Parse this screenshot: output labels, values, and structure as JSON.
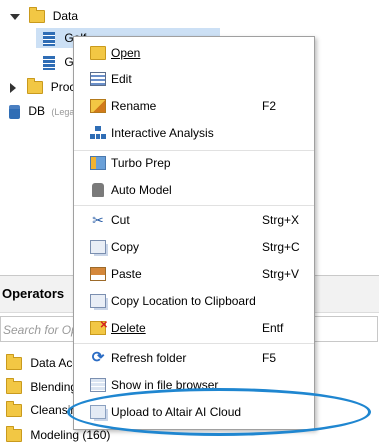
{
  "tree": {
    "data_folder": "Data",
    "item1": "Golf",
    "item2": "Go",
    "processes": "Proce",
    "db": "DB",
    "db_note": "(Lega"
  },
  "operators": {
    "title": "Operators",
    "search_placeholder": "Search for Op",
    "categories": [
      {
        "label": "Data Acc"
      },
      {
        "label": "Blending"
      },
      {
        "label": "Cleansin"
      },
      {
        "label": "Modeling (160)"
      }
    ]
  },
  "context_menu": {
    "items": [
      {
        "label": "Open",
        "shortcut": ""
      },
      {
        "label": "Edit",
        "shortcut": ""
      },
      {
        "label": "Rename",
        "shortcut": "F2"
      },
      {
        "label": "Interactive Analysis",
        "shortcut": ""
      },
      {
        "label": "Turbo Prep",
        "shortcut": ""
      },
      {
        "label": "Auto Model",
        "shortcut": ""
      },
      {
        "label": "Cut",
        "shortcut": "Strg+X"
      },
      {
        "label": "Copy",
        "shortcut": "Strg+C"
      },
      {
        "label": "Paste",
        "shortcut": "Strg+V"
      },
      {
        "label": "Copy Location to Clipboard",
        "shortcut": ""
      },
      {
        "label": "Delete",
        "shortcut": "Entf"
      },
      {
        "label": "Refresh folder",
        "shortcut": "F5"
      },
      {
        "label": "Show in file browser",
        "shortcut": ""
      },
      {
        "label": "Upload to Altair AI Cloud",
        "shortcut": ""
      }
    ]
  },
  "colors": {
    "selection": "#cce0f5",
    "highlight_ring": "#1f86d0"
  }
}
